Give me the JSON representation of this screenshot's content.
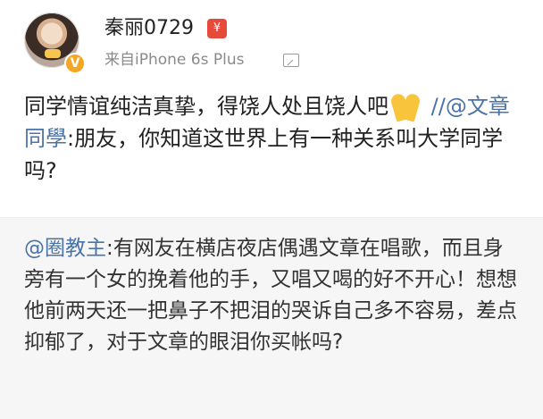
{
  "header": {
    "username": "秦丽0729",
    "red_packet_icon": "¥",
    "source": "来自iPhone 6s Plus"
  },
  "post": {
    "text_1": "同学情谊纯洁真挚，得饶人处且饶人吧",
    "mention_prefix": "//@文章同學",
    "text_2": ":朋友，你知道这世界上有一种关系叫大学同学吗?"
  },
  "repost": {
    "mention": "@圈教主",
    "text": ":有网友在横店夜店偶遇文章在唱歌，而且身旁有一个女的挽着他的手，又唱又喝的好不开心！想想他前两天还一把鼻子不把泪的哭诉自己多不容易，差点抑郁了，对于文章的眼泪你买帐吗?"
  },
  "colors": {
    "mention": "#4a73a8",
    "vip_badge": "#f5a623",
    "red_packet": "#e64a3b",
    "repost_bg": "#f6f6f6"
  },
  "icons": [
    "avatar",
    "vip-badge-icon",
    "red-packet-icon",
    "image-icon",
    "praying-hands-icon"
  ]
}
